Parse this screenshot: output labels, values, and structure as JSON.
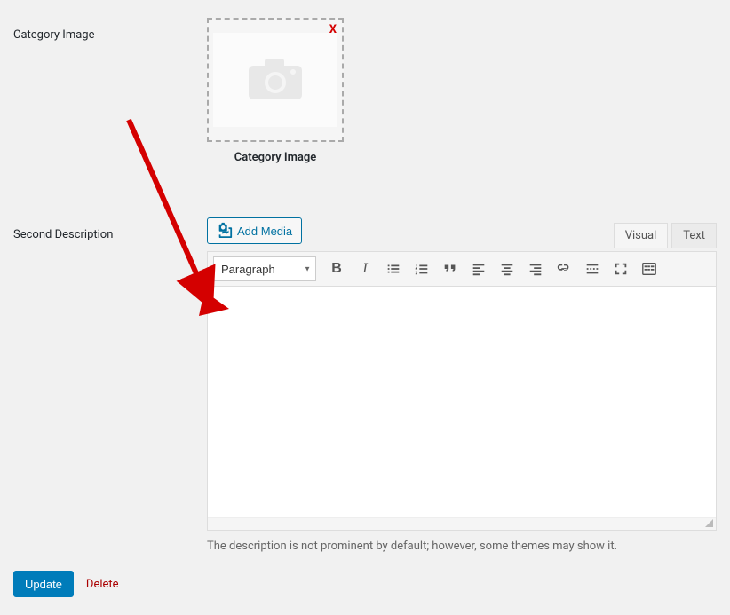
{
  "category_image": {
    "label": "Category Image",
    "remove_label": "X",
    "caption": "Category Image"
  },
  "second_description": {
    "label": "Second Description",
    "add_media_label": "Add Media",
    "tabs": {
      "visual": "Visual",
      "text": "Text"
    },
    "format_dropdown": "Paragraph",
    "hint": "The description is not prominent by default; however, some themes may show it."
  },
  "buttons": {
    "update": "Update",
    "delete": "Delete"
  },
  "colors": {
    "primary": "#007cba",
    "link": "#0071a1",
    "danger": "#a00",
    "remove_x": "#d40000"
  }
}
